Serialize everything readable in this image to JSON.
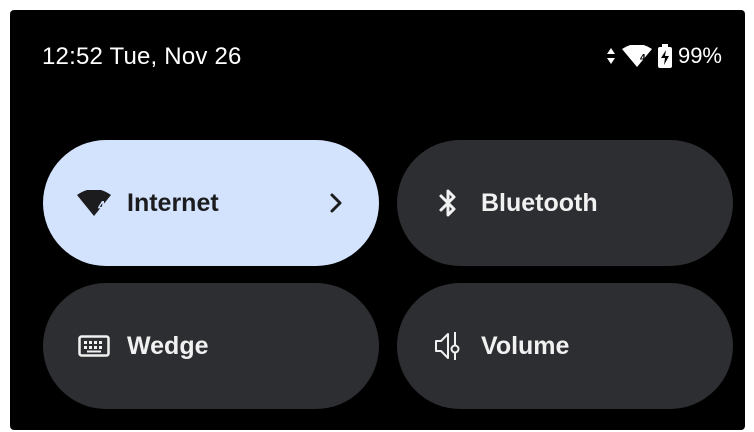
{
  "status_bar": {
    "time_date": "12:52 Tue, Nov 26",
    "battery_percent": "99%",
    "wifi_badge": "4",
    "icons": [
      "data-updown-icon",
      "wifi-icon",
      "battery-charging-icon"
    ]
  },
  "tiles": [
    {
      "label": "Internet",
      "icon": "wifi-icon",
      "active": true,
      "has_chevron": true,
      "badge": "4"
    },
    {
      "label": "Bluetooth",
      "icon": "bluetooth-icon",
      "active": false
    },
    {
      "label": "Wedge",
      "icon": "keyboard-icon",
      "active": false
    },
    {
      "label": "Volume",
      "icon": "volume-icon",
      "active": false
    }
  ],
  "colors": {
    "background": "#000000",
    "tile_active": "#d3e3fd",
    "tile_inactive": "#2d2e31",
    "text_light": "#f1f1f1",
    "text_dark": "#1c1c1e"
  }
}
